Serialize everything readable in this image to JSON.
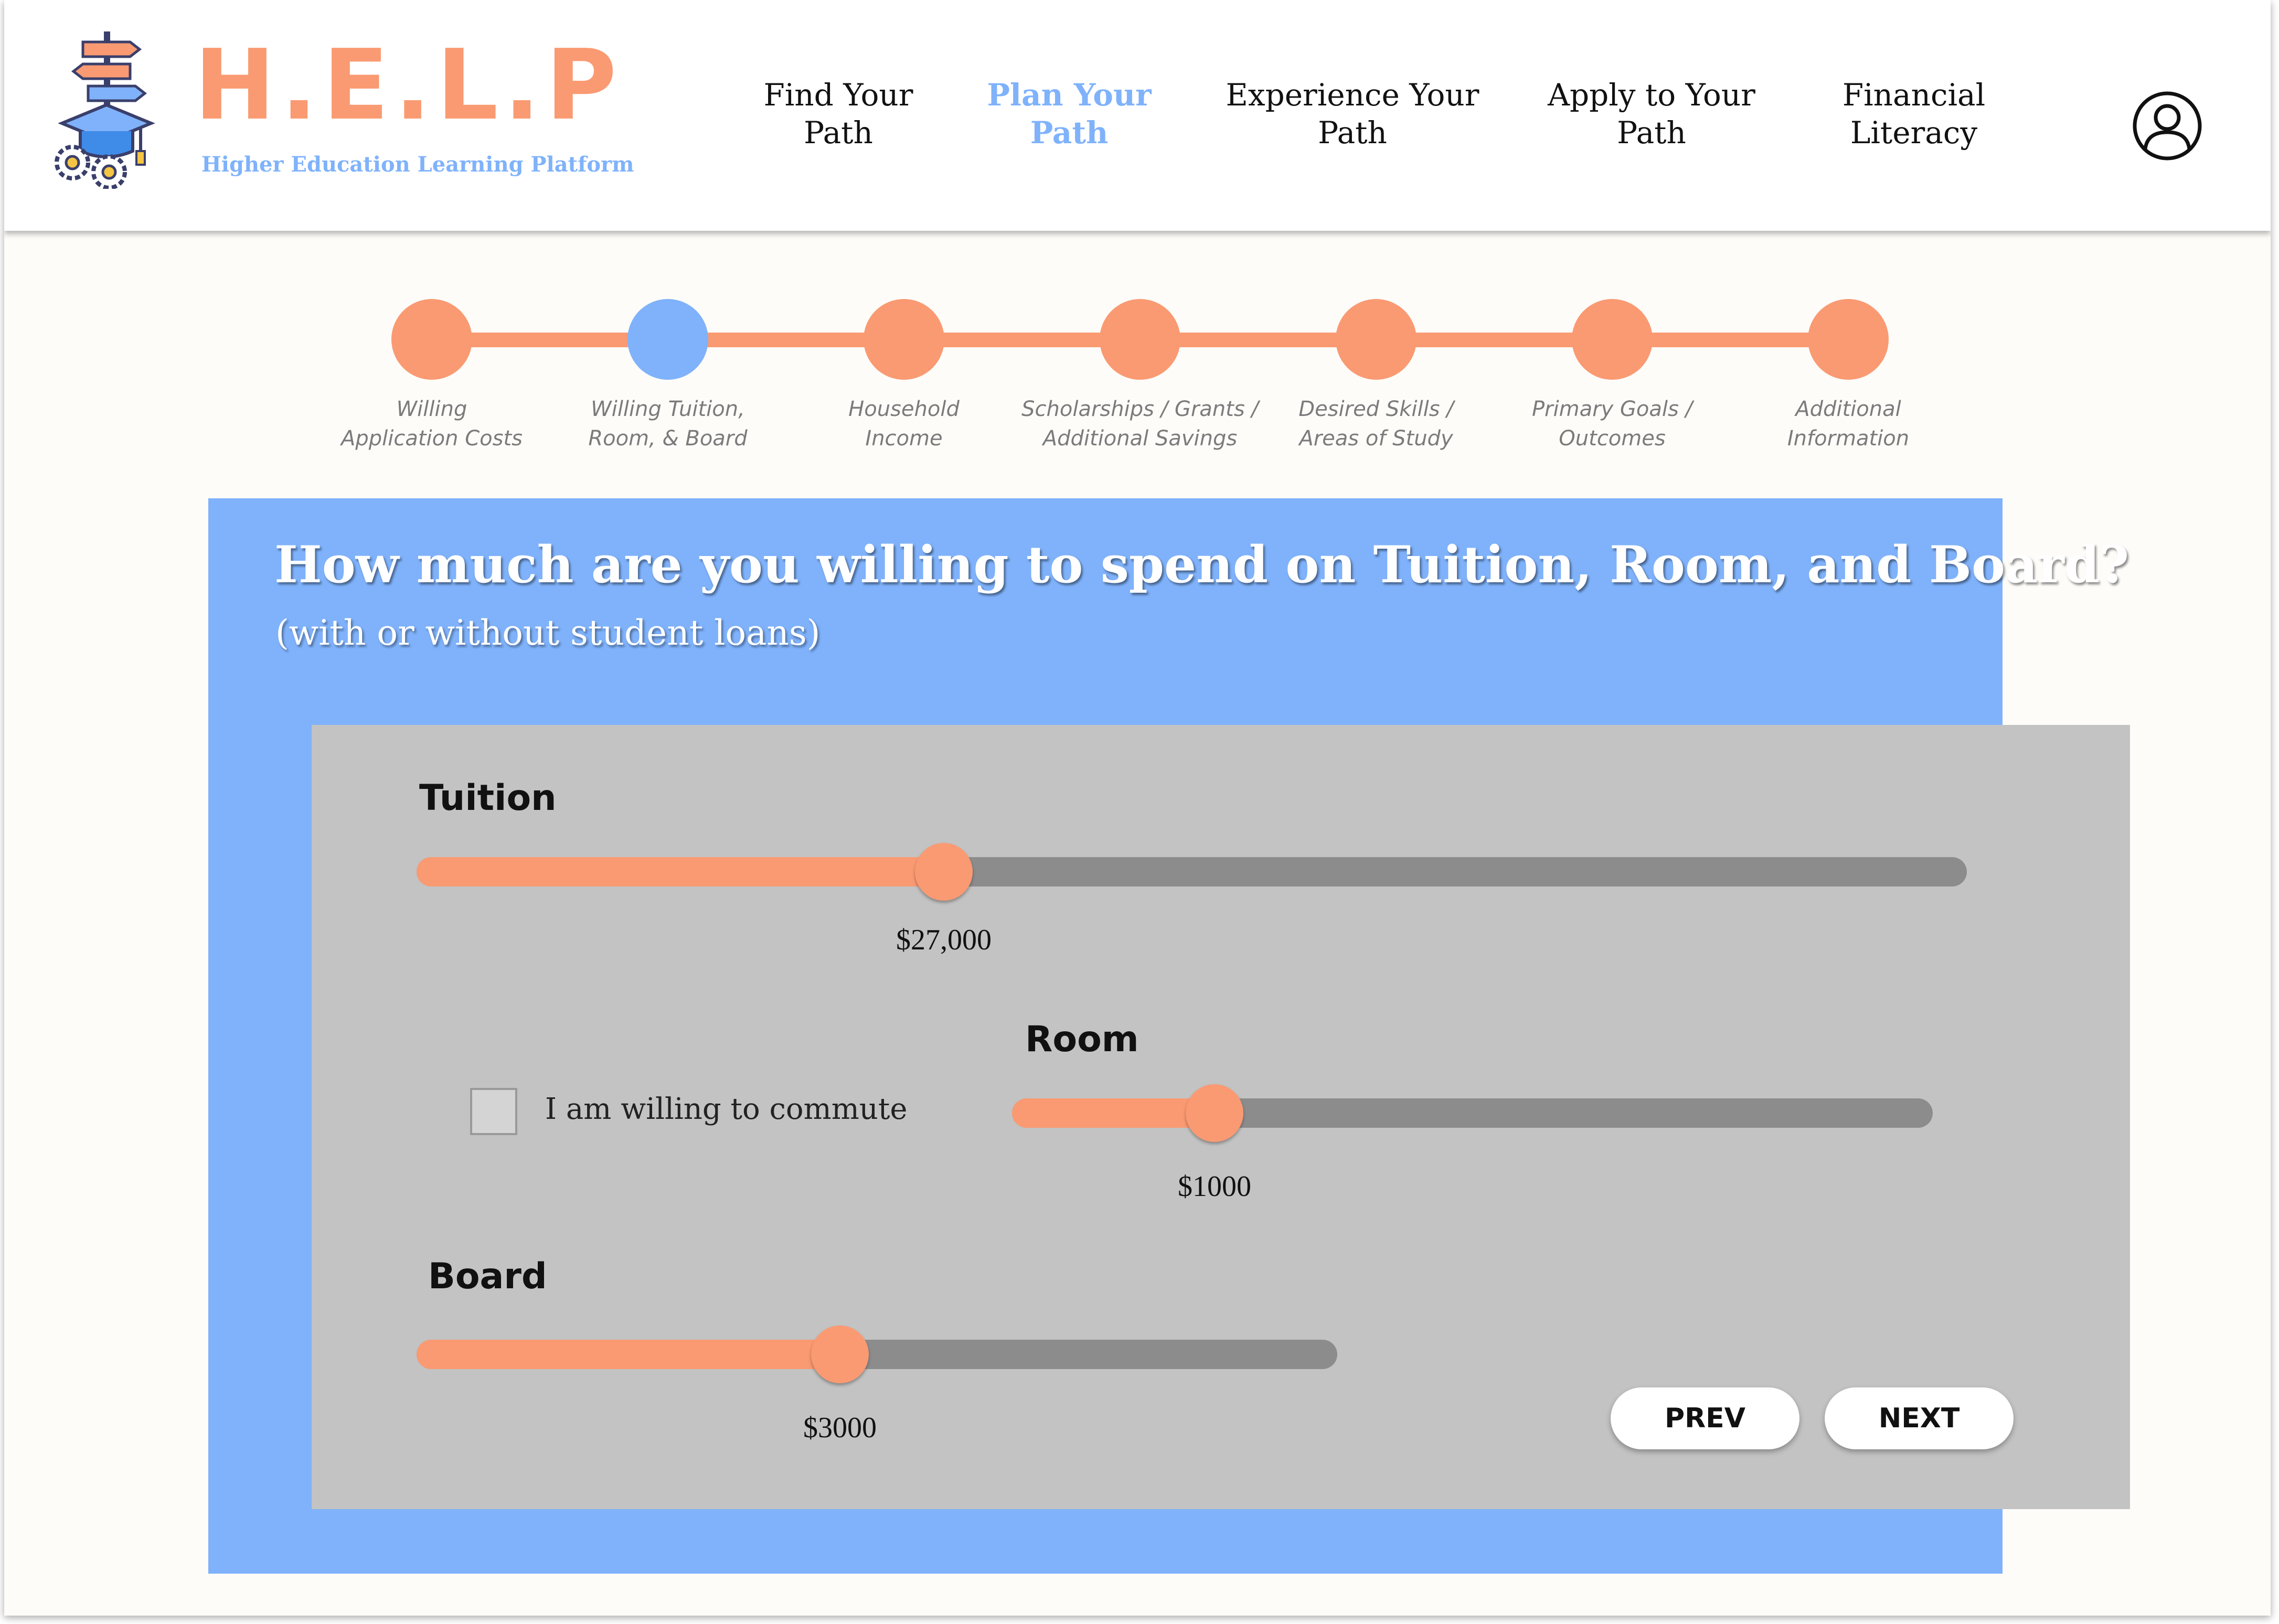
{
  "brand": {
    "title": "H.E.L.P",
    "subtitle": "Higher Education Learning Platform",
    "logo_icon": "signpost-graduation-cap-gears-icon",
    "primary_color": "#fa9a72",
    "accent_color": "#7fb2fb"
  },
  "nav": {
    "items": [
      {
        "line1": "Find Your",
        "line2": "Path",
        "active": false
      },
      {
        "line1": "Plan Your",
        "line2": "Path",
        "active": true
      },
      {
        "line1": "Experience Your",
        "line2": "Path",
        "active": false
      },
      {
        "line1": "Apply to Your",
        "line2": "Path",
        "active": false
      },
      {
        "line1": "Financial",
        "line2": "Literacy",
        "active": false
      }
    ],
    "profile_icon": "user-profile-icon"
  },
  "stepper": {
    "current_step": 2,
    "steps": [
      {
        "line1": "Willing",
        "line2": "Application Costs"
      },
      {
        "line1": "Willing Tuition,",
        "line2": "Room, & Board"
      },
      {
        "line1": "Household",
        "line2": "Income"
      },
      {
        "line1": "Scholarships / Grants /",
        "line2": "Additional Savings"
      },
      {
        "line1": "Desired Skills /",
        "line2": "Areas of Study"
      },
      {
        "line1": "Primary Goals /",
        "line2": "Outcomes"
      },
      {
        "line1": "Additional",
        "line2": "Information"
      }
    ]
  },
  "question": {
    "title": "How much are you willing to spend on Tuition, Room, and Board?",
    "subtitle": "(with or without student loans)"
  },
  "form": {
    "tuition": {
      "label": "Tuition",
      "value_text": "$27,000",
      "level": 0.34
    },
    "room": {
      "label": "Room",
      "value_text": "$1000",
      "level": 0.22
    },
    "board": {
      "label": "Board",
      "value_text": "$3000",
      "level": 0.46
    },
    "commute": {
      "label": "I am willing to commute",
      "checked": false
    }
  },
  "buttons": {
    "prev": "PREV",
    "next": "NEXT"
  }
}
